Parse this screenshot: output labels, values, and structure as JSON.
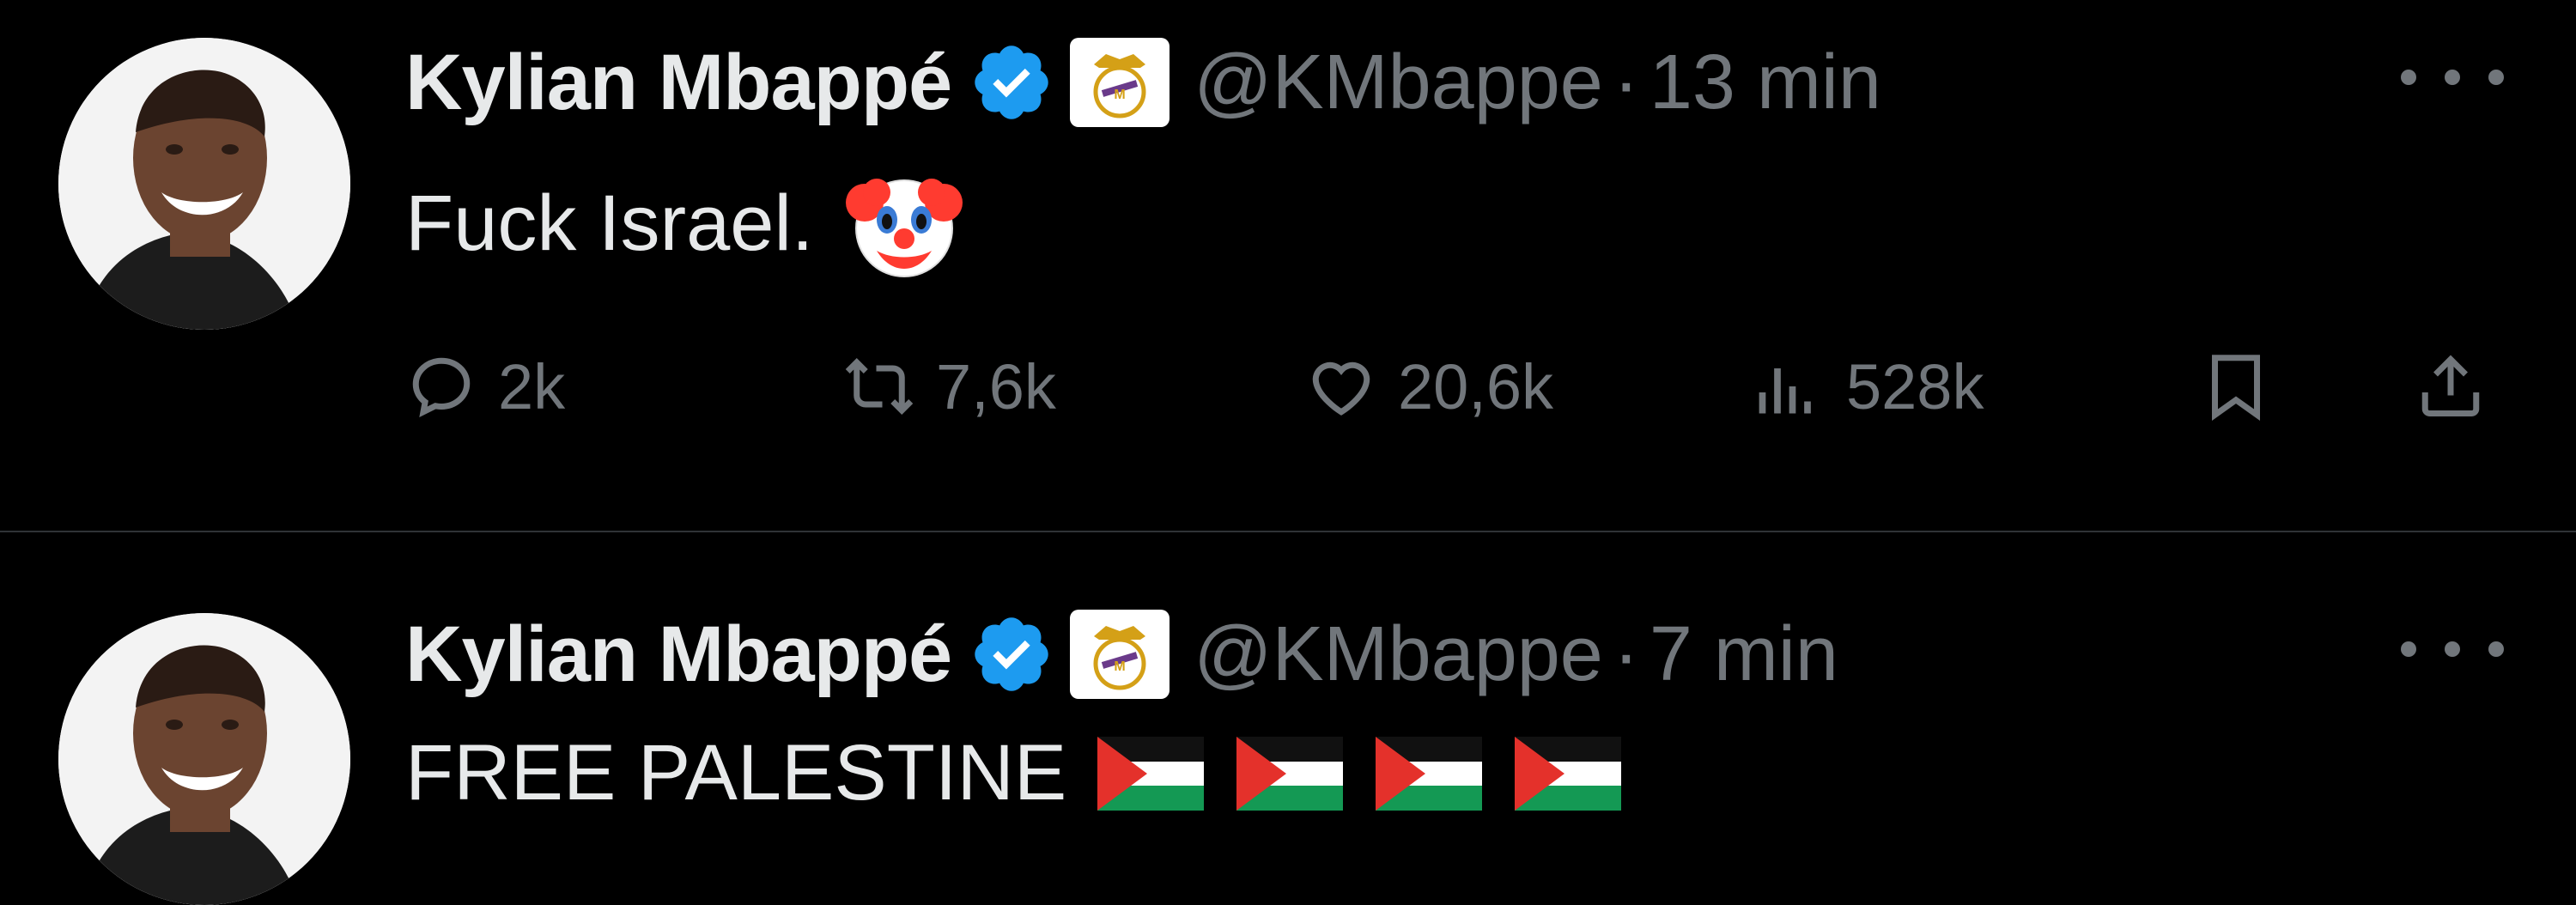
{
  "tweets": [
    {
      "author_name": "Kylian Mbappé",
      "handle": "@KMbappe",
      "separator": "·",
      "time": "13 min",
      "text": "Fuck Israel.",
      "emoji": "clown-face",
      "replies": "2k",
      "reposts": "7,6k",
      "likes": "20,6k",
      "views": "528k"
    },
    {
      "author_name": "Kylian Mbappé",
      "handle": "@KMbappe",
      "separator": "·",
      "time": "7 min",
      "text": "FREE PALESTINE",
      "emoji": "palestine-flag x4"
    }
  ],
  "colors": {
    "background": "#000000",
    "primary_text": "#e7e9ea",
    "secondary_text": "#71767b",
    "verified_blue": "#1d9bf0",
    "divider": "#2f3336"
  }
}
